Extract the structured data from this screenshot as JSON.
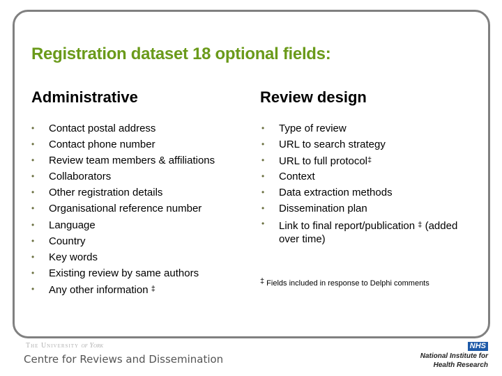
{
  "title": "Registration dataset 18 optional fields:",
  "colors": {
    "title": "#6a9a1a",
    "frame": "#808080",
    "bullet": "#6b7040",
    "nhs_blue": "#1e5aa8"
  },
  "columns": {
    "left": {
      "heading": "Administrative",
      "items": [
        {
          "text": "Contact postal address",
          "mark": ""
        },
        {
          "text": "Contact phone number",
          "mark": ""
        },
        {
          "text": "Review team members & affiliations",
          "mark": ""
        },
        {
          "text": "Collaborators",
          "mark": ""
        },
        {
          "text": "Other registration details",
          "mark": ""
        },
        {
          "text": "Organisational reference number",
          "mark": ""
        },
        {
          "text": "Language",
          "mark": ""
        },
        {
          "text": "Country",
          "mark": ""
        },
        {
          "text": "Key words",
          "mark": ""
        },
        {
          "text": "Existing review by same authors",
          "mark": ""
        },
        {
          "text": "Any other information ",
          "mark": "‡"
        }
      ]
    },
    "right": {
      "heading": "Review design",
      "items": [
        {
          "text": "Type of review",
          "mark": "",
          "after": ""
        },
        {
          "text": "URL to search strategy",
          "mark": "",
          "after": ""
        },
        {
          "text": "URL to full protocol",
          "mark": "‡",
          "after": ""
        },
        {
          "text": "Context",
          "mark": "",
          "after": ""
        },
        {
          "text": "Data extraction methods",
          "mark": "",
          "after": ""
        },
        {
          "text": "Dissemination plan",
          "mark": "",
          "after": ""
        },
        {
          "text": "Link to final report/publication ",
          "mark": "‡",
          "after": " (added over time)"
        }
      ]
    }
  },
  "bullet_glyph": "•",
  "footnote": {
    "mark": "‡",
    "text": " Fields included in response to Delphi comments"
  },
  "footer": {
    "university": "The University",
    "university_of": "of York",
    "centre": "Centre for Reviews and Dissemination",
    "nhs": "NHS",
    "nihr_line1": "National Institute for",
    "nihr_line2": "Health Research"
  }
}
